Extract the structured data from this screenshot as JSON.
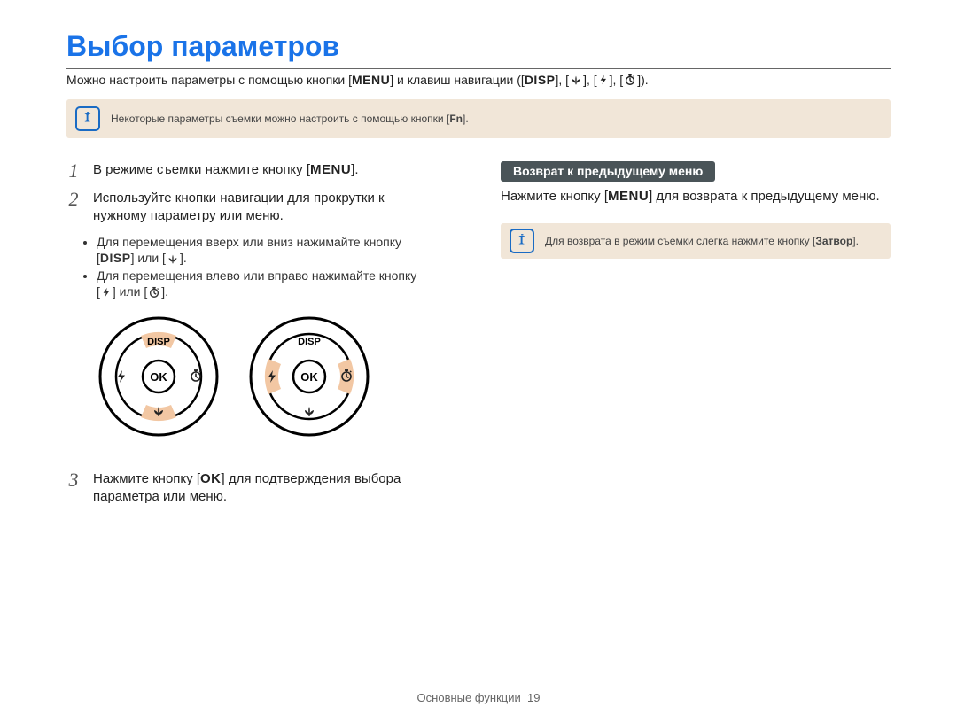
{
  "title": "Выбор параметров",
  "intro": {
    "part1": "Можно настроить параметры с помощью кнопки [",
    "menu": "MENU",
    "part2": "] и клавиш навигации ([",
    "disp": "DISP",
    "part3": "], [",
    "comma": "], [",
    "end": "])."
  },
  "note1": {
    "prefix": "Некоторые параметры съемки можно настроить с помощью кнопки [",
    "fn": "Fn",
    "suffix": "]."
  },
  "steps": {
    "s1": {
      "num": "1",
      "prefix": "В режиме съемки нажмите кнопку [",
      "menu": "MENU",
      "suffix": "]."
    },
    "s2": {
      "num": "2",
      "line1": "Используйте кнопки навигации для прокрутки к",
      "line2": "нужному параметру или меню.",
      "bullet1": {
        "text": "Для перемещения вверх или вниз нажимайте кнопку",
        "sub_open": "[",
        "disp": "DISP",
        "sub_mid": "] или [",
        "sub_close": "]."
      },
      "bullet2": {
        "text": "Для перемещения влево или вправо нажимайте кнопку",
        "sub_open": "[",
        "sub_mid": "] или [",
        "sub_close": "]."
      }
    },
    "s3": {
      "num": "3",
      "prefix": "Нажмите кнопку [",
      "ok": "OK",
      "mid": "] для подтверждения выбора",
      "line2": "параметра или меню."
    }
  },
  "right": {
    "heading": "Возврат к предыдущему меню",
    "prefix": "Нажмите кнопку [",
    "menu": "MENU",
    "suffix": "] для возврата к предыдущему меню."
  },
  "note2": {
    "prefix": "Для возврата в режим съемки слегка нажмите кнопку [",
    "shutter": "Затвор",
    "suffix": "]."
  },
  "dial": {
    "disp": "DISP",
    "ok": "OK"
  },
  "footer": {
    "label": "Основные функции",
    "page": "19"
  }
}
